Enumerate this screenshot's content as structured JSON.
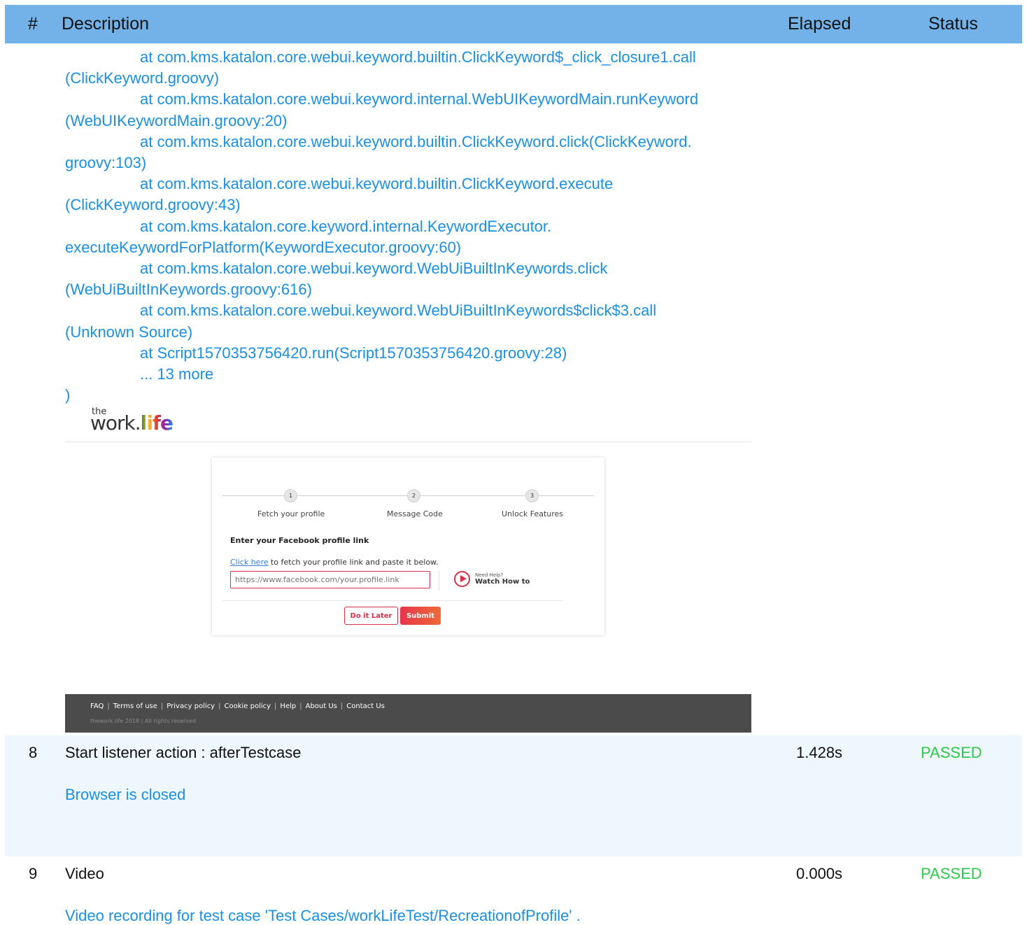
{
  "header": {
    "num": "#",
    "description": "Description",
    "elapsed": "Elapsed",
    "status": "Status"
  },
  "stacktrace": [
    {
      "text": "at com.kms.katalon.core.webui.keyword.builtin.ClickKeyword$_click_closure1.call",
      "indent": true
    },
    {
      "text": "(ClickKeyword.groovy)",
      "indent": false
    },
    {
      "text": "at com.kms.katalon.core.webui.keyword.internal.WebUIKeywordMain.runKeyword",
      "indent": true
    },
    {
      "text": "(WebUIKeywordMain.groovy:20)",
      "indent": false
    },
    {
      "text": "at com.kms.katalon.core.webui.keyword.builtin.ClickKeyword.click(ClickKeyword.",
      "indent": true
    },
    {
      "text": "groovy:103)",
      "indent": false
    },
    {
      "text": "at com.kms.katalon.core.webui.keyword.builtin.ClickKeyword.execute",
      "indent": true
    },
    {
      "text": "(ClickKeyword.groovy:43)",
      "indent": false
    },
    {
      "text": "at com.kms.katalon.core.keyword.internal.KeywordExecutor.",
      "indent": true
    },
    {
      "text": "executeKeywordForPlatform(KeywordExecutor.groovy:60)",
      "indent": false
    },
    {
      "text": "at com.kms.katalon.core.webui.keyword.WebUiBuiltInKeywords.click",
      "indent": true
    },
    {
      "text": "(WebUiBuiltInKeywords.groovy:616)",
      "indent": false
    },
    {
      "text": "at com.kms.katalon.core.webui.keyword.WebUiBuiltInKeywords$click$3.call",
      "indent": true
    },
    {
      "text": "(Unknown Source)",
      "indent": false
    },
    {
      "text": "at Script1570353756420.run(Script1570353756420.groovy:28)",
      "indent": true
    },
    {
      "text": "... 13 more",
      "indent": true
    },
    {
      "text": ")",
      "indent": false
    }
  ],
  "screenshot": {
    "logo_the": "the",
    "logo_work": "work.",
    "logo_life": "life",
    "steps": [
      {
        "number": "1",
        "label": "Fetch your profile"
      },
      {
        "number": "2",
        "label": "Message Code"
      },
      {
        "number": "3",
        "label": "Unlock Features"
      }
    ],
    "title": "Enter your Facebook profile link",
    "help_link": "Click here",
    "help_text": " to fetch your profile link and paste it below.",
    "input_placeholder": "https://www.facebook.com/your.profile.link",
    "need_help": "Need Help?",
    "watch_how": "Watch How to",
    "btn_later": "Do it Later",
    "btn_submit": "Submit",
    "footer_links": [
      "FAQ",
      "Terms of use",
      "Privacy policy",
      "Cookie policy",
      "Help",
      "About Us",
      "Contact Us"
    ],
    "footer_copy": "thework.life 2018 | All rights reserved"
  },
  "rows": [
    {
      "num": "8",
      "description": "Start listener action : afterTestcase",
      "elapsed": "1.428s",
      "status": "PASSED",
      "log": "Browser is closed"
    },
    {
      "num": "9",
      "description": "Video",
      "elapsed": "0.000s",
      "status": "PASSED",
      "log": "Video recording for test case 'Test Cases/workLifeTest/RecreationofProfile' ."
    }
  ],
  "colors": {
    "header_bg": "#72b2e8",
    "link": "#1a8fe6",
    "passed": "#2ec84a",
    "accent": "#d9304a",
    "row_alt_bg": "#eef6fe"
  }
}
